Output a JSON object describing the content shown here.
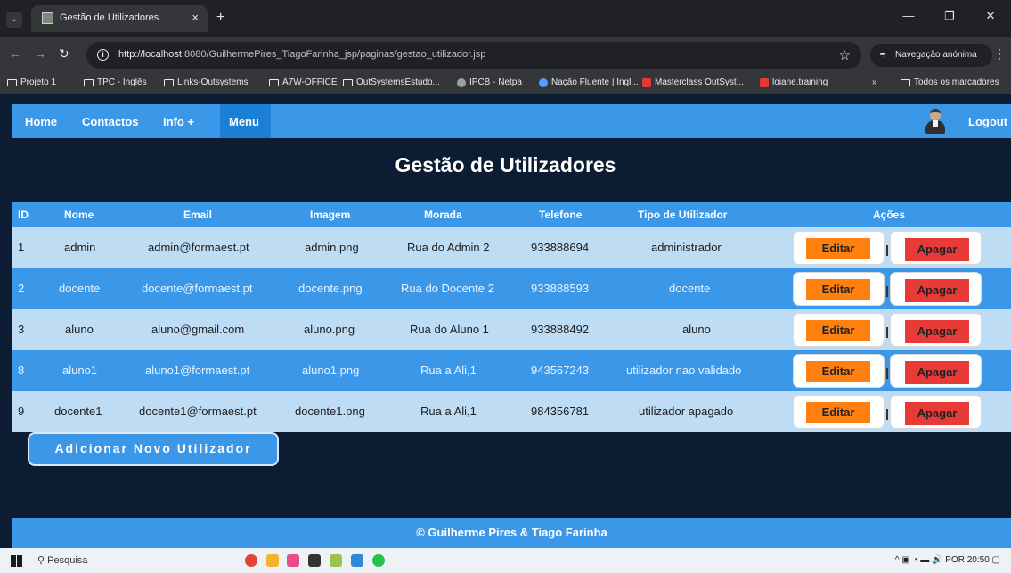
{
  "browser": {
    "tab_title": "Gestão de Utilizadores",
    "tab_close": "×",
    "new_tab": "+",
    "win_minimize": "—",
    "win_restore": "❐",
    "win_close": "✕",
    "url_host": "http://localhost",
    "url_rest": ":8080/GuilhermePires_TiagoFarinha_jsp/paginas/gestao_utilizador.jsp",
    "incognito_label": "Navegação anónima",
    "bookmarks": [
      {
        "label": "Projeto 1",
        "icon": "folder-icon"
      },
      {
        "label": "TPC - Inglês",
        "icon": "folder-icon"
      },
      {
        "label": "Links-Outsystems",
        "icon": "folder-icon"
      },
      {
        "label": "A7W-OFFICE",
        "icon": "folder-icon"
      },
      {
        "label": "OutSystemsEstudo...",
        "icon": "folder-icon"
      },
      {
        "label": "IPCB - Netpa",
        "icon": "globe-icon"
      },
      {
        "label": "Nação Fluente | Ingl...",
        "icon": "site-icon"
      },
      {
        "label": "Masterclass OutSyst...",
        "icon": "site-icon"
      },
      {
        "label": "loiane.training",
        "icon": "site-icon"
      }
    ],
    "bookmarks_more": "»",
    "all_bookmarks": "Todos os marcadores"
  },
  "nav": {
    "home": "Home",
    "contactos": "Contactos",
    "info": "Info +",
    "menu": "Menu",
    "logout": "Logout"
  },
  "page_title": "Gestão de Utilizadores",
  "table": {
    "headers": [
      "ID",
      "Nome",
      "Email",
      "Imagem",
      "Morada",
      "Telefone",
      "Tipo de Utilizador",
      "Ações"
    ],
    "rows": [
      {
        "id": "1",
        "nome": "admin",
        "email": "admin@formaest.pt",
        "imagem": "admin.png",
        "morada": "Rua do Admin 2",
        "telefone": "933888694",
        "tipo": "administrador"
      },
      {
        "id": "2",
        "nome": "docente",
        "email": "docente@formaest.pt",
        "imagem": "docente.png",
        "morada": "Rua do Docente 2",
        "telefone": "933888593",
        "tipo": "docente"
      },
      {
        "id": "3",
        "nome": "aluno",
        "email": "aluno@gmail.com",
        "imagem": "aluno.png",
        "morada": "Rua do Aluno 1",
        "telefone": "933888492",
        "tipo": "aluno"
      },
      {
        "id": "8",
        "nome": "aluno1",
        "email": "aluno1@formaest.pt",
        "imagem": "aluno1.png",
        "morada": "Rua a Ali,1",
        "telefone": "943567243",
        "tipo": "utilizador nao validado"
      },
      {
        "id": "9",
        "nome": "docente1",
        "email": "docente1@formaest.pt",
        "imagem": "docente1.png",
        "morada": "Rua a Ali,1",
        "telefone": "984356781",
        "tipo": "utilizador apagado"
      }
    ],
    "edit_label": "Editar",
    "delete_label": "Apagar"
  },
  "add_button": "Adicionar Novo Utilizador",
  "footer": "© Guilherme Pires & Tiago Farinha",
  "taskbar": {
    "search": "Pesquisa",
    "language": "POR",
    "time": "20:50"
  },
  "colors": {
    "page_bg": "#0c1d33",
    "accent": "#3b97e8",
    "row_light": "#bfdcf5",
    "edit": "#ff7f0f",
    "delete": "#e83a36"
  }
}
